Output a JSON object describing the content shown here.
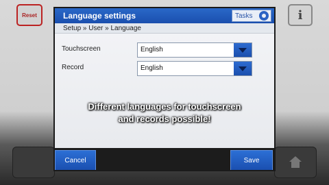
{
  "device": {
    "reset_label": "Reset",
    "info_label": "i"
  },
  "window": {
    "title": "Language settings",
    "tasks_label": "Tasks"
  },
  "breadcrumb": "Setup » User » Language",
  "fields": [
    {
      "label": "Touchscreen",
      "value": "English"
    },
    {
      "label": "Record",
      "value": "English"
    }
  ],
  "overlay": {
    "line1": "Different languages for touchscreen",
    "line2": "and records possible!"
  },
  "footer": {
    "cancel_label": "Cancel",
    "save_label": "Save"
  },
  "colors": {
    "accent": "#1a4fae",
    "title_bar": "#2a68c8"
  }
}
